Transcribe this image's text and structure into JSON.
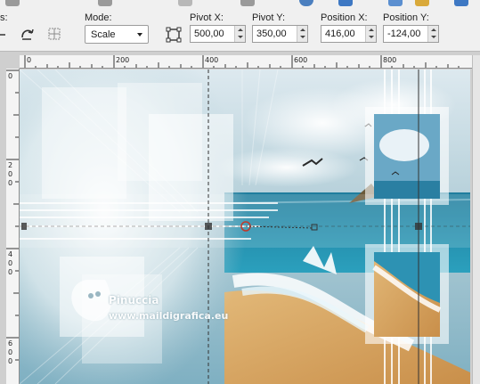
{
  "toolbar": {
    "left_cut_label": "s:",
    "mode_label": "Mode:",
    "mode_value": "Scale",
    "pivot_x_label": "Pivot X:",
    "pivot_x_value": "500,00",
    "pivot_y_label": "Pivot Y:",
    "pivot_y_value": "350,00",
    "position_x_label": "Position X:",
    "position_x_value": "416,00",
    "position_y_label": "Position Y:",
    "position_y_value": "-124,00"
  },
  "ruler": {
    "h_labels": [
      "0",
      "200",
      "400",
      "600",
      "800"
    ],
    "v_labels": [
      [
        "0"
      ],
      [
        "2",
        "0",
        "0"
      ],
      [
        "4",
        "0",
        "0"
      ],
      [
        "6",
        "0",
        "0"
      ]
    ]
  },
  "watermark": {
    "name": "Pinuccia",
    "url": "www.maildigrafica.eu"
  },
  "colors": {
    "accent_blue": "#3b6fb6",
    "canvas_sea": "#2f8fae",
    "sand": "#d6a25c"
  }
}
